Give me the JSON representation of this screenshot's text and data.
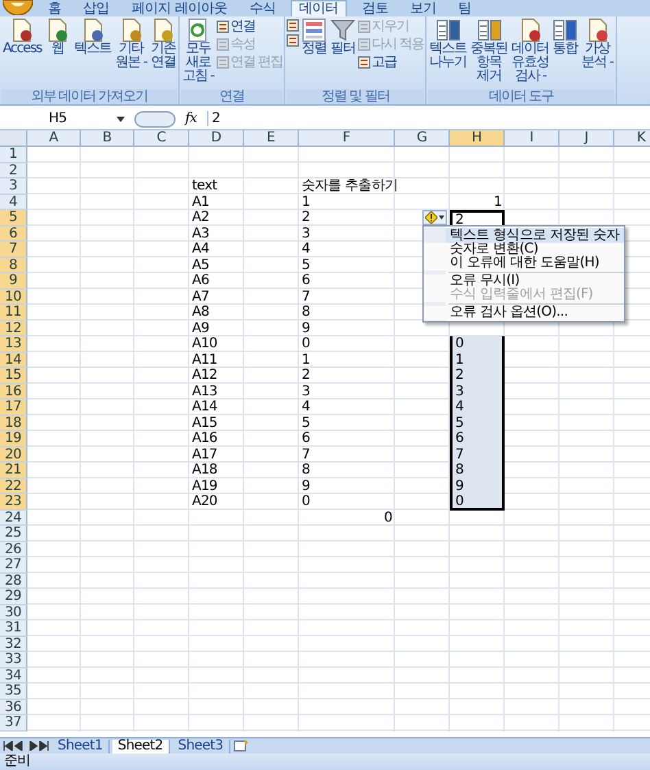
{
  "ribbon": {
    "tabs": [
      {
        "label": "홈",
        "selected": false
      },
      {
        "label": "삽입",
        "selected": false
      },
      {
        "label": "페이지 레이아웃",
        "selected": false
      },
      {
        "label": "수식",
        "selected": false
      },
      {
        "label": "데이터",
        "selected": true
      },
      {
        "label": "검토",
        "selected": false
      },
      {
        "label": "보기",
        "selected": false
      },
      {
        "label": "팀",
        "selected": false
      }
    ],
    "groups": [
      {
        "label": "외부 데이터 가져오기",
        "items": [
          {
            "kind": "large",
            "label": "Access"
          },
          {
            "kind": "large",
            "label": "웹"
          },
          {
            "kind": "large",
            "label": "텍스트"
          },
          {
            "kind": "large",
            "label": "기타\n원본 -"
          },
          {
            "kind": "large",
            "label": "기존\n연결"
          }
        ]
      },
      {
        "label": "연결",
        "items": [
          {
            "kind": "large",
            "label": "모두\n새로\n고침 -"
          },
          {
            "kind": "stack",
            "items": [
              {
                "label": "연결",
                "disabled": false
              },
              {
                "label": "속성",
                "disabled": true
              },
              {
                "label": "연결 편집",
                "disabled": true
              }
            ]
          }
        ]
      },
      {
        "label": "정렬 및 필터",
        "items": [
          {
            "kind": "stack",
            "items": [
              {
                "disabled": false
              },
              {
                "disabled": false
              }
            ]
          },
          {
            "kind": "large",
            "label": "정렬"
          },
          {
            "kind": "large",
            "label": "필터"
          },
          {
            "kind": "stack",
            "items": [
              {
                "label": "지우기",
                "disabled": true
              },
              {
                "label": "다시 적용",
                "disabled": true
              },
              {
                "label": "고급",
                "disabled": false
              }
            ]
          }
        ]
      },
      {
        "label": "데이터 도구",
        "items": [
          {
            "kind": "large",
            "label": "텍스트\n나누기"
          },
          {
            "kind": "large",
            "label": "중복된\n항목\n제거"
          },
          {
            "kind": "large",
            "label": "데이터\n유효성\n검사 -"
          },
          {
            "kind": "large",
            "label": "통합"
          },
          {
            "kind": "large",
            "label": "가상\n분석 -"
          }
        ]
      }
    ]
  },
  "formula_bar": {
    "name_box": "H5",
    "function_label": "fx",
    "value": "2"
  },
  "grid": {
    "columns": [
      {
        "label": "A",
        "selected": false
      },
      {
        "label": "B",
        "selected": false
      },
      {
        "label": "C",
        "selected": false
      },
      {
        "label": "D",
        "selected": false
      },
      {
        "label": "E",
        "selected": false
      },
      {
        "label": "F",
        "selected": false
      },
      {
        "label": "G",
        "selected": false
      },
      {
        "label": "H",
        "selected": true
      },
      {
        "label": "I",
        "selected": false
      },
      {
        "label": "J",
        "selected": false
      },
      {
        "label": "K",
        "selected": false
      }
    ],
    "rows": [
      {
        "number": "1",
        "selected": false,
        "cells": {}
      },
      {
        "number": "2",
        "selected": false,
        "cells": {}
      },
      {
        "number": "3",
        "selected": false,
        "cells": {
          "D": {
            "text": "text",
            "kind": "text"
          },
          "F": {
            "text": "숫자를 추출하기",
            "kind": "text"
          }
        }
      },
      {
        "number": "4",
        "selected": false,
        "cells": {
          "D": {
            "text": "A1",
            "kind": "text"
          },
          "F": {
            "text": "1",
            "kind": "text"
          },
          "H": {
            "text": "1",
            "kind": "number"
          }
        }
      },
      {
        "number": "5",
        "selected": true,
        "cells": {
          "D": {
            "text": "A2",
            "kind": "text"
          },
          "F": {
            "text": "2",
            "kind": "text"
          },
          "H": {
            "text": "2",
            "kind": "text",
            "selected": true,
            "active": true
          }
        }
      },
      {
        "number": "6",
        "selected": true,
        "cells": {
          "D": {
            "text": "A3",
            "kind": "text"
          },
          "F": {
            "text": "3",
            "kind": "text"
          }
        }
      },
      {
        "number": "7",
        "selected": true,
        "cells": {
          "D": {
            "text": "A4",
            "kind": "text"
          },
          "F": {
            "text": "4",
            "kind": "text"
          }
        }
      },
      {
        "number": "8",
        "selected": true,
        "cells": {
          "D": {
            "text": "A5",
            "kind": "text"
          },
          "F": {
            "text": "5",
            "kind": "text"
          }
        }
      },
      {
        "number": "9",
        "selected": true,
        "cells": {
          "D": {
            "text": "A6",
            "kind": "text"
          },
          "F": {
            "text": "6",
            "kind": "text"
          }
        }
      },
      {
        "number": "10",
        "selected": true,
        "cells": {
          "D": {
            "text": "A7",
            "kind": "text"
          },
          "F": {
            "text": "7",
            "kind": "text"
          }
        }
      },
      {
        "number": "11",
        "selected": true,
        "cells": {
          "D": {
            "text": "A8",
            "kind": "text"
          },
          "F": {
            "text": "8",
            "kind": "text"
          }
        }
      },
      {
        "number": "12",
        "selected": true,
        "cells": {
          "D": {
            "text": "A9",
            "kind": "text"
          },
          "F": {
            "text": "9",
            "kind": "text"
          }
        }
      },
      {
        "number": "13",
        "selected": true,
        "cells": {
          "D": {
            "text": "A10",
            "kind": "text"
          },
          "F": {
            "text": "0",
            "kind": "text"
          },
          "H": {
            "text": "0",
            "kind": "text",
            "selected": true
          }
        }
      },
      {
        "number": "14",
        "selected": true,
        "cells": {
          "D": {
            "text": "A11",
            "kind": "text"
          },
          "F": {
            "text": "1",
            "kind": "text"
          },
          "H": {
            "text": "1",
            "kind": "text",
            "selected": true
          }
        }
      },
      {
        "number": "15",
        "selected": true,
        "cells": {
          "D": {
            "text": "A12",
            "kind": "text"
          },
          "F": {
            "text": "2",
            "kind": "text"
          },
          "H": {
            "text": "2",
            "kind": "text",
            "selected": true
          }
        }
      },
      {
        "number": "16",
        "selected": true,
        "cells": {
          "D": {
            "text": "A13",
            "kind": "text"
          },
          "F": {
            "text": "3",
            "kind": "text"
          },
          "H": {
            "text": "3",
            "kind": "text",
            "selected": true
          }
        }
      },
      {
        "number": "17",
        "selected": true,
        "cells": {
          "D": {
            "text": "A14",
            "kind": "text"
          },
          "F": {
            "text": "4",
            "kind": "text"
          },
          "H": {
            "text": "4",
            "kind": "text",
            "selected": true
          }
        }
      },
      {
        "number": "18",
        "selected": true,
        "cells": {
          "D": {
            "text": "A15",
            "kind": "text"
          },
          "F": {
            "text": "5",
            "kind": "text"
          },
          "H": {
            "text": "5",
            "kind": "text",
            "selected": true
          }
        }
      },
      {
        "number": "19",
        "selected": true,
        "cells": {
          "D": {
            "text": "A16",
            "kind": "text"
          },
          "F": {
            "text": "6",
            "kind": "text"
          },
          "H": {
            "text": "6",
            "kind": "text",
            "selected": true
          }
        }
      },
      {
        "number": "20",
        "selected": true,
        "cells": {
          "D": {
            "text": "A17",
            "kind": "text"
          },
          "F": {
            "text": "7",
            "kind": "text"
          },
          "H": {
            "text": "7",
            "kind": "text",
            "selected": true
          }
        }
      },
      {
        "number": "21",
        "selected": true,
        "cells": {
          "D": {
            "text": "A18",
            "kind": "text"
          },
          "F": {
            "text": "8",
            "kind": "text"
          },
          "H": {
            "text": "8",
            "kind": "text",
            "selected": true
          }
        }
      },
      {
        "number": "22",
        "selected": true,
        "cells": {
          "D": {
            "text": "A19",
            "kind": "text"
          },
          "F": {
            "text": "9",
            "kind": "text"
          },
          "H": {
            "text": "9",
            "kind": "text",
            "selected": true
          }
        }
      },
      {
        "number": "23",
        "selected": true,
        "cells": {
          "D": {
            "text": "A20",
            "kind": "text"
          },
          "F": {
            "text": "0",
            "kind": "text"
          },
          "H": {
            "text": "0",
            "kind": "text",
            "selected": true
          }
        }
      },
      {
        "number": "24",
        "selected": false,
        "cells": {
          "F": {
            "text": "0",
            "kind": "number"
          }
        }
      },
      {
        "number": "25",
        "selected": false,
        "cells": {}
      },
      {
        "number": "26",
        "selected": false,
        "cells": {}
      },
      {
        "number": "27",
        "selected": false,
        "cells": {}
      },
      {
        "number": "28",
        "selected": false,
        "cells": {}
      },
      {
        "number": "29",
        "selected": false,
        "cells": {}
      },
      {
        "number": "30",
        "selected": false,
        "cells": {}
      },
      {
        "number": "31",
        "selected": false,
        "cells": {}
      },
      {
        "number": "32",
        "selected": false,
        "cells": {}
      },
      {
        "number": "33",
        "selected": false,
        "cells": {}
      },
      {
        "number": "34",
        "selected": false,
        "cells": {}
      },
      {
        "number": "35",
        "selected": false,
        "cells": {}
      },
      {
        "number": "36",
        "selected": false,
        "cells": {}
      },
      {
        "number": "37",
        "selected": false,
        "cells": {}
      }
    ]
  },
  "error_menu": {
    "items": [
      {
        "kind": "header",
        "label": "텍스트 형식으로 저장된 숫자"
      },
      {
        "kind": "item",
        "label": "숫자로 변환(C)",
        "disabled": false
      },
      {
        "kind": "item",
        "label": "이 오류에 대한 도움말(H)",
        "disabled": false
      },
      {
        "kind": "separator"
      },
      {
        "kind": "item",
        "label": "오류 무시(I)",
        "disabled": false
      },
      {
        "kind": "item",
        "label": "수식 입력줄에서 편집(F)",
        "disabled": true
      },
      {
        "kind": "separator"
      },
      {
        "kind": "item",
        "label": "오류 검사 옵션(O)...",
        "disabled": false
      }
    ]
  },
  "sheet_tabs": [
    {
      "label": "Sheet1",
      "selected": false
    },
    {
      "label": "Sheet2",
      "selected": true
    },
    {
      "label": "Sheet3",
      "selected": false
    }
  ],
  "status_bar": {
    "text": "준비"
  }
}
